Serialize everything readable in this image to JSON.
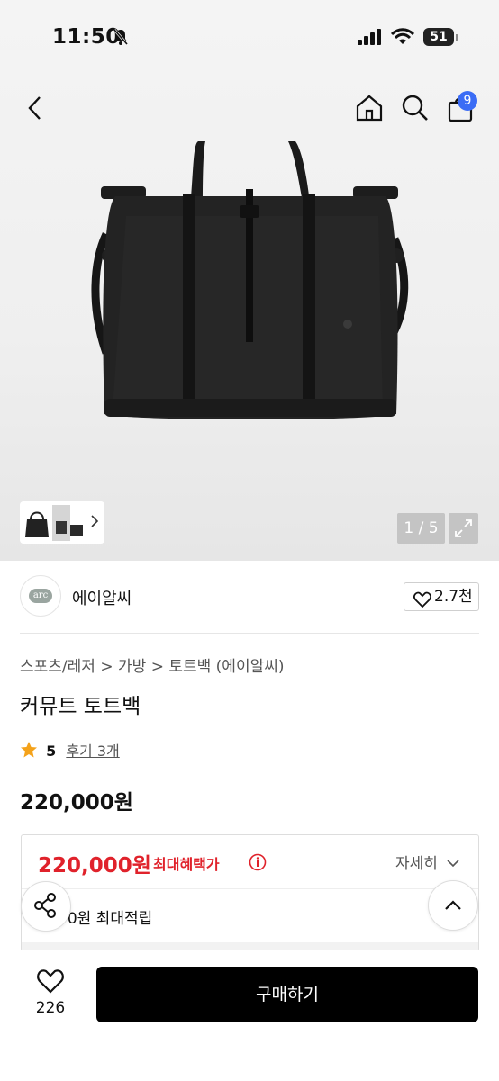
{
  "status_bar": {
    "time": "11:50",
    "battery": "51"
  },
  "header": {
    "cart_count": "9"
  },
  "gallery": {
    "counter": "1 / 5"
  },
  "brand": {
    "name": "에이알씨",
    "logo_text": "arc",
    "likes": "2.7천"
  },
  "breadcrumb": [
    "스포츠/레저",
    "가방",
    "토트백 (에이알씨)"
  ],
  "product": {
    "title": "커뮤트 토트백",
    "rating": "5",
    "review_link": "후기 3개",
    "price": "220,000원"
  },
  "benefit": {
    "best_price": "220,000원",
    "best_label": "최대혜택가",
    "detail_label": "자세히",
    "points": "00원 최대적립"
  },
  "bottom": {
    "wish_count": "226",
    "buy_label": "구매하기"
  },
  "colors": {
    "accent_red": "#e0222b",
    "badge_blue": "#3b6cf5",
    "buy_black": "#000000"
  }
}
